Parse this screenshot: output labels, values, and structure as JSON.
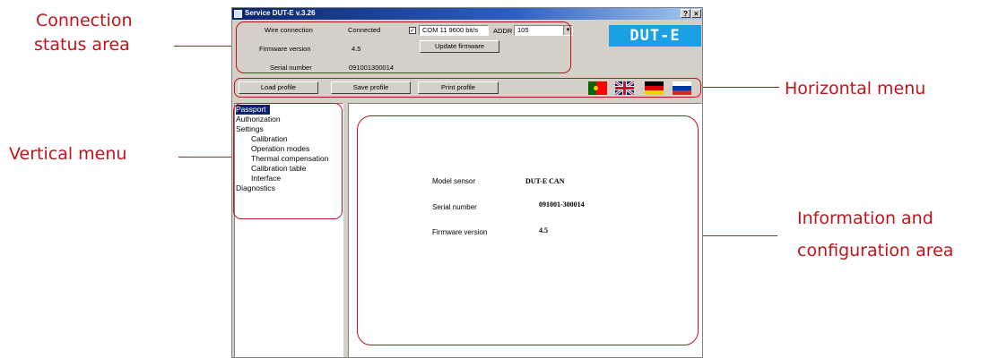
{
  "annotations": {
    "connection_status_line1": "Connection",
    "connection_status_line2": "status area",
    "vertical_menu": "Vertical menu",
    "horizontal_menu": "Horizontal menu",
    "info_area_line1": "Information and",
    "info_area_line2": "configuration area"
  },
  "window": {
    "title": "Service DUT-E  v.3.26",
    "help_button": "?",
    "close_button": "×"
  },
  "status": {
    "wire_connection_label": "Wire connection",
    "wire_connection_value": "Connected",
    "firmware_version_label": "Firmware version",
    "firmware_version_value": "4.5",
    "serial_number_label": "Serial number",
    "serial_number_value": "091001300014",
    "port_checked": true,
    "port_value": "COM 11   9600 bit/s",
    "addr_label": "ADDR",
    "addr_value": "105",
    "update_firmware_label": "Update firmware",
    "logo_text": "DUT-E"
  },
  "toolbar": {
    "load_profile": "Load profile",
    "save_profile": "Save profile",
    "print_profile": "Print profile",
    "flags": [
      "portugal-flag-icon",
      "uk-flag-icon",
      "germany-flag-icon",
      "russia-flag-icon"
    ]
  },
  "nav": {
    "items": [
      {
        "label": "Passport",
        "selected": true,
        "indent": 0
      },
      {
        "label": "Authorization",
        "indent": 0
      },
      {
        "label": "Settings",
        "indent": 0
      },
      {
        "label": "Calibration",
        "indent": 1
      },
      {
        "label": "Operation modes",
        "indent": 1
      },
      {
        "label": "Thermal compensation",
        "indent": 1
      },
      {
        "label": "Calibration table",
        "indent": 1
      },
      {
        "label": "Interface",
        "indent": 1
      },
      {
        "label": "Diagnostics",
        "indent": 0
      }
    ]
  },
  "passport": {
    "model_label": "Model sensor",
    "model_value": "DUT-E CAN",
    "serial_label": "Serial number",
    "serial_value": "091001-300014",
    "firmware_label": "Firmware version",
    "firmware_value": "4.5"
  },
  "colors": {
    "annotation_red": "#c0141c",
    "selection_blue": "#0a246a",
    "logo_blue": "#1aa0e4",
    "window_gray": "#d4d0c8"
  }
}
